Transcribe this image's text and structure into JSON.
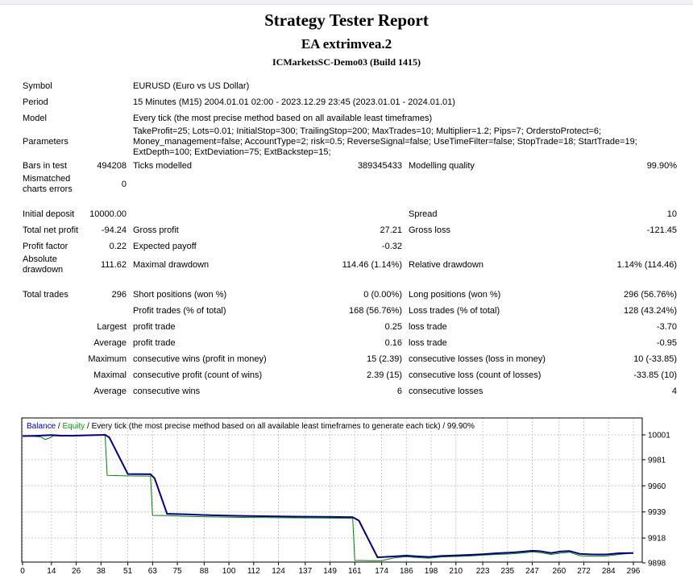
{
  "header": {
    "title": "Strategy Tester Report",
    "ea_name": "EA extrimvea.2",
    "server": "ICMarketsSC-Demo03 (Build 1415)"
  },
  "table": {
    "rows": [
      {
        "cells": [
          {
            "l": "Symbol"
          },
          {
            "l": "EURUSD (Euro vs US Dollar)",
            "span": true
          }
        ]
      },
      {
        "cells": [
          {
            "l": "Period"
          },
          {
            "l": "15 Minutes (M15) 2004.01.01 02:00 - 2023.12.29 23:45 (2023.01.01 - 2024.01.01)",
            "span": true
          }
        ]
      },
      {
        "cells": [
          {
            "l": "Model"
          },
          {
            "l": "Every tick (the most precise method based on all available least timeframes)",
            "span": true
          }
        ]
      },
      {
        "cells": [
          {
            "l": "Parameters"
          },
          {
            "l": "TakeProfit=25; Lots=0.01; InitialStop=300; TrailingStop=200; MaxTrades=10; Multiplier=1.2; Pips=7; OrderstoProtect=6; Money_management=false; AccountType=2; risk=0.5; ReverseSignal=false; UseTimeFilter=false; StopTrade=18; StartTrade=19; ExtDepth=100; ExtDeviation=75; ExtBackstep=15;",
            "span": true
          }
        ]
      },
      {
        "cells": [
          {
            "l": "Bars in test",
            "v": "494208"
          },
          {
            "l": "Ticks modelled",
            "v": "389345433"
          },
          {
            "l": "Modelling quality",
            "v": "99.90%"
          }
        ]
      },
      {
        "cells": [
          {
            "l": "Mismatched charts errors",
            "v": "0"
          },
          {},
          {}
        ]
      },
      {
        "spacer": true
      },
      {
        "cells": [
          {
            "l": "Initial deposit",
            "v": "10000.00"
          },
          {},
          {
            "l": "Spread",
            "v": "10"
          }
        ]
      },
      {
        "cells": [
          {
            "l": "Total net profit",
            "v": "-94.24"
          },
          {
            "l": "Gross profit",
            "v": "27.21"
          },
          {
            "l": "Gross loss",
            "v": "-121.45"
          }
        ]
      },
      {
        "cells": [
          {
            "l": "Profit factor",
            "v": "0.22"
          },
          {
            "l": "Expected payoff",
            "v": "-0.32"
          },
          {}
        ]
      },
      {
        "cells": [
          {
            "l": "Absolute drawdown",
            "v": "111.62"
          },
          {
            "l": "Maximal drawdown",
            "v": "114.46 (1.14%)"
          },
          {
            "l": "Relative drawdown",
            "v": "1.14% (114.46)"
          }
        ]
      },
      {
        "spacer": true
      },
      {
        "cells": [
          {
            "l": "Total trades",
            "v": "296"
          },
          {
            "l": "Short positions (won %)",
            "v": "0 (0.00%)"
          },
          {
            "l": "Long positions (won %)",
            "v": "296 (56.76%)"
          }
        ]
      },
      {
        "cells": [
          {},
          {
            "l": "Profit trades (% of total)",
            "v": "168 (56.76%)"
          },
          {
            "l": "Loss trades (% of total)",
            "v": "128 (43.24%)"
          }
        ]
      },
      {
        "cells": [
          {
            "v": "Largest"
          },
          {
            "l": "profit trade",
            "v": "0.25"
          },
          {
            "l": "loss trade",
            "v": "-3.70"
          }
        ]
      },
      {
        "cells": [
          {
            "v": "Average"
          },
          {
            "l": "profit trade",
            "v": "0.16"
          },
          {
            "l": "loss trade",
            "v": "-0.95"
          }
        ]
      },
      {
        "cells": [
          {
            "v": "Maximum"
          },
          {
            "l": "consecutive wins (profit in money)",
            "v": "15 (2.39)"
          },
          {
            "l": "consecutive losses (loss in money)",
            "v": "10 (-33.85)"
          }
        ]
      },
      {
        "cells": [
          {
            "v": "Maximal"
          },
          {
            "l": "consecutive profit (count of wins)",
            "v": "2.39 (15)"
          },
          {
            "l": "consecutive loss (count of losses)",
            "v": "-33.85 (10)"
          }
        ]
      },
      {
        "cells": [
          {
            "v": "Average"
          },
          {
            "l": "consecutive wins",
            "v": "6"
          },
          {
            "l": "consecutive losses",
            "v": "4"
          }
        ]
      }
    ]
  },
  "chart_data": {
    "type": "line",
    "legend": {
      "balance_label": "Balance",
      "sep1": " / ",
      "equity_label": "Equity",
      "rest": " / Every tick (the most precise method based on all available least timeframes to generate each tick) / 99.90%"
    },
    "x_ticks": [
      0,
      14,
      26,
      38,
      51,
      63,
      75,
      88,
      100,
      112,
      124,
      137,
      149,
      161,
      174,
      186,
      198,
      210,
      223,
      235,
      247,
      260,
      272,
      284,
      296
    ],
    "y_ticks": [
      10001,
      9981,
      9960,
      9939,
      9918,
      9898
    ],
    "x_range": [
      0,
      296
    ],
    "y_range": [
      9898,
      10001
    ],
    "grid": true,
    "legend_position": "top-left-inside",
    "colors": {
      "balance_line": "#000080",
      "equity_line": "#008000",
      "balance_legend": "#0000cc",
      "equity_legend": "#00a000",
      "gridline": "#c8c8c8",
      "border": "#000000"
    },
    "series": [
      {
        "name": "Equity",
        "points": [
          [
            0,
            10000
          ],
          [
            6,
            9999.8
          ],
          [
            9,
            9999.2
          ],
          [
            11,
            9997.3
          ],
          [
            13,
            9998.5
          ],
          [
            15,
            10000.3
          ],
          [
            18,
            10000.1
          ],
          [
            24,
            10000
          ],
          [
            30,
            10000.4
          ],
          [
            36,
            10000.7
          ],
          [
            40,
            10001
          ],
          [
            41,
            9968.5
          ],
          [
            46,
            9968.2
          ],
          [
            51,
            9968
          ],
          [
            62,
            9967.8
          ],
          [
            63,
            9936.2
          ],
          [
            70,
            9936
          ],
          [
            80,
            9935.4
          ],
          [
            92,
            9935
          ],
          [
            106,
            9934.6
          ],
          [
            120,
            9934.4
          ],
          [
            136,
            9934.2
          ],
          [
            150,
            9934
          ],
          [
            160,
            9933.8
          ],
          [
            161,
            9900
          ],
          [
            168,
            9899.8
          ],
          [
            174,
            9899.8
          ],
          [
            180,
            9902
          ],
          [
            186,
            9903
          ],
          [
            192,
            9902.2
          ],
          [
            197,
            9901.8
          ],
          [
            203,
            9902.8
          ],
          [
            210,
            9903.2
          ],
          [
            217,
            9903.6
          ],
          [
            223,
            9904.2
          ],
          [
            230,
            9904.8
          ],
          [
            236,
            9905.2
          ],
          [
            242,
            9906
          ],
          [
            247,
            9906.8
          ],
          [
            251,
            9906.2
          ],
          [
            256,
            9904.8
          ],
          [
            261,
            9906
          ],
          [
            265,
            9906.6
          ],
          [
            270,
            9903.8
          ],
          [
            276,
            9903.4
          ],
          [
            283,
            9903.6
          ],
          [
            289,
            9904.8
          ],
          [
            296,
            9906
          ]
        ]
      },
      {
        "name": "Balance",
        "points": [
          [
            0,
            10000
          ],
          [
            6,
            10000.2
          ],
          [
            10,
            10000.5
          ],
          [
            14,
            10000.8
          ],
          [
            18,
            10000.4
          ],
          [
            24,
            10000.3
          ],
          [
            30,
            10000.6
          ],
          [
            36,
            10000.8
          ],
          [
            40,
            10001
          ],
          [
            42,
            9999
          ],
          [
            51,
            9969.5
          ],
          [
            62,
            9969.3
          ],
          [
            64,
            9966
          ],
          [
            70,
            9937.5
          ],
          [
            80,
            9937
          ],
          [
            92,
            9936.3
          ],
          [
            106,
            9935.8
          ],
          [
            120,
            9935.5
          ],
          [
            136,
            9935.2
          ],
          [
            150,
            9935
          ],
          [
            160,
            9934.8
          ],
          [
            163,
            9932
          ],
          [
            172,
            9902.5
          ],
          [
            178,
            9903
          ],
          [
            186,
            9903.8
          ],
          [
            192,
            9903.2
          ],
          [
            197,
            9902.8
          ],
          [
            203,
            9903.6
          ],
          [
            210,
            9904
          ],
          [
            217,
            9904.5
          ],
          [
            223,
            9905
          ],
          [
            230,
            9905.8
          ],
          [
            236,
            9906.2
          ],
          [
            242,
            9907
          ],
          [
            247,
            9907.8
          ],
          [
            251,
            9907.4
          ],
          [
            256,
            9906
          ],
          [
            261,
            9907.2
          ],
          [
            265,
            9907.6
          ],
          [
            270,
            9905.3
          ],
          [
            276,
            9904.8
          ],
          [
            283,
            9904.8
          ],
          [
            289,
            9905.8
          ],
          [
            296,
            9906
          ]
        ]
      }
    ]
  }
}
